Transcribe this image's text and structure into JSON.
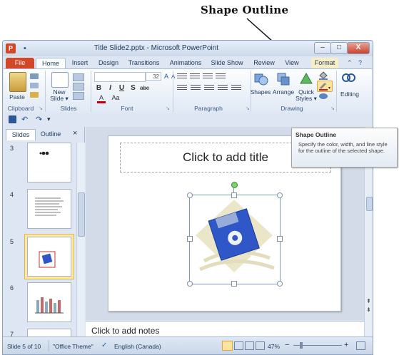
{
  "annotation": {
    "label": "Shape Outline"
  },
  "window": {
    "title": "Title Slide2.pptx - Microsoft PowerPoint",
    "app_icon": "P",
    "controls": {
      "minimize": "–",
      "maximize": "□",
      "close": "X"
    }
  },
  "tabs": [
    "File",
    "Home",
    "Insert",
    "Design",
    "Transitions",
    "Animations",
    "Slide Show",
    "Review",
    "View",
    "Format"
  ],
  "ribbon": {
    "clipboard": {
      "paste": "Paste",
      "label": "Clipboard"
    },
    "slides": {
      "new_slide_line1": "New",
      "new_slide_line2": "Slide ▾",
      "label": "Slides"
    },
    "font": {
      "size": "32",
      "bold": "B",
      "italic": "I",
      "underline": "U",
      "shadow": "S",
      "strike": "abc",
      "label": "Font"
    },
    "paragraph": {
      "label": "Paragraph"
    },
    "drawing": {
      "shapes": "Shapes",
      "arrange": "Arrange",
      "quick_styles_line1": "Quick",
      "quick_styles_line2": "Styles ▾",
      "label": "Drawing"
    },
    "editing": {
      "label": "Editing"
    }
  },
  "pane": {
    "tabs": [
      "Slides",
      "Outline"
    ],
    "close": "×",
    "slides": [
      {
        "num": "3"
      },
      {
        "num": "4"
      },
      {
        "num": "5"
      },
      {
        "num": "6"
      },
      {
        "num": "7"
      }
    ]
  },
  "slide": {
    "title_placeholder": "Click to add title"
  },
  "notes": {
    "placeholder": "Click to add notes"
  },
  "status": {
    "slide_info": "Slide 5 of 10",
    "theme": "\"Office Theme\"",
    "language": "English (Canada)",
    "zoom": "47%"
  },
  "tooltip": {
    "title": "Shape Outline",
    "body": "Specify the color, width, and line style for the outline of the selected shape."
  },
  "colors": {
    "file_tab": "#d24726",
    "ribbon_bg": "#dfe8f4",
    "selection": "#7c99c4",
    "diskette": "#2f57c8"
  }
}
